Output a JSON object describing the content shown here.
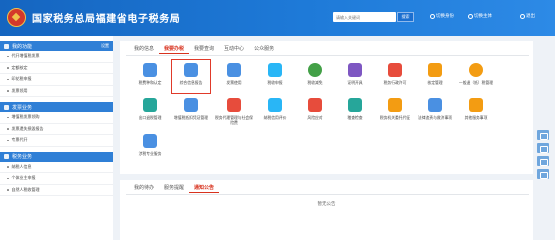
{
  "header": {
    "site_title": "国家税务总局福建省电子税务局",
    "search_placeholder": "请输入关键词",
    "search_button": "搜索",
    "links": [
      {
        "label": "切换身份",
        "icon": "switch-user-icon"
      },
      {
        "label": "切换主体",
        "icon": "switch-entity-icon"
      },
      {
        "label": "退出",
        "icon": "logout-icon"
      }
    ]
  },
  "sidebar": {
    "sections": [
      {
        "title": "我的功能",
        "more": "设置",
        "icon": "grid-icon",
        "items": [
          "代开增值税发票",
          "定额核定",
          "印花税申报",
          "发票领用"
        ]
      },
      {
        "title": "发票业务",
        "icon": "invoice-icon",
        "items": [
          "增值税发票领购",
          "发票遗失损毁报告",
          "专票代开"
        ]
      },
      {
        "title": "税务业务",
        "icon": "tax-icon",
        "items": [
          "纳税人信息",
          "个体业主申报",
          "自然人税收管理"
        ]
      }
    ]
  },
  "main": {
    "tabs": [
      "我的信息",
      "我要办税",
      "我要查询",
      "互动中心",
      "公众服务"
    ],
    "active_tab": "我要办税",
    "tiles": [
      {
        "label": "税费种和认定",
        "icon": "box-icon",
        "color": "#4a90e2"
      },
      {
        "label": "综合信息报告",
        "icon": "document-icon",
        "color": "#4a90e2"
      },
      {
        "label": "发票使用",
        "icon": "invoice-icon",
        "color": "#4a90e2"
      },
      {
        "label": "税收申报",
        "icon": "report-icon",
        "color": "#29b6f6"
      },
      {
        "label": "税收减免",
        "icon": "discount-icon",
        "color": "#43a047"
      },
      {
        "label": "证明开具",
        "icon": "certificate-icon",
        "color": "#7e57c2"
      },
      {
        "label": "税务行政许可",
        "icon": "license-icon",
        "color": "#e74c3c"
      },
      {
        "label": "核定管理",
        "icon": "edit-icon",
        "color": "#f39c12"
      },
      {
        "label": "一般退（抵）税管理",
        "icon": "refund-icon",
        "color": "#f39c12"
      },
      {
        "label": "出口退税管理",
        "icon": "export-icon",
        "color": "#26a69a"
      },
      {
        "label": "增值税抵扣凭证管理",
        "icon": "deduct-icon",
        "color": "#4a90e2"
      },
      {
        "label": "税务代理管理与社会保险费",
        "icon": "agent-icon",
        "color": "#e74c3c"
      },
      {
        "label": "纳税信用评价",
        "icon": "credit-icon",
        "color": "#29b6f6"
      },
      {
        "label": "风险应对",
        "icon": "risk-icon",
        "color": "#e74c3c"
      },
      {
        "label": "稽查检查",
        "icon": "inspect-icon",
        "color": "#26a69a"
      },
      {
        "label": "税务机关委托代征",
        "icon": "collect-icon",
        "color": "#f39c12"
      },
      {
        "label": "法律追责与救济事项",
        "icon": "law-icon",
        "color": "#4a90e2"
      },
      {
        "label": "其他服务事项",
        "icon": "other-icon",
        "color": "#f39c12"
      },
      {
        "label": "涉税专业服务",
        "icon": "service-icon",
        "color": "#4a90e2"
      }
    ]
  },
  "notice": {
    "tabs": [
      "我的待办",
      "服务提醒",
      "通知公告"
    ],
    "active_tab": "通知公告",
    "empty": "暂无公告"
  }
}
